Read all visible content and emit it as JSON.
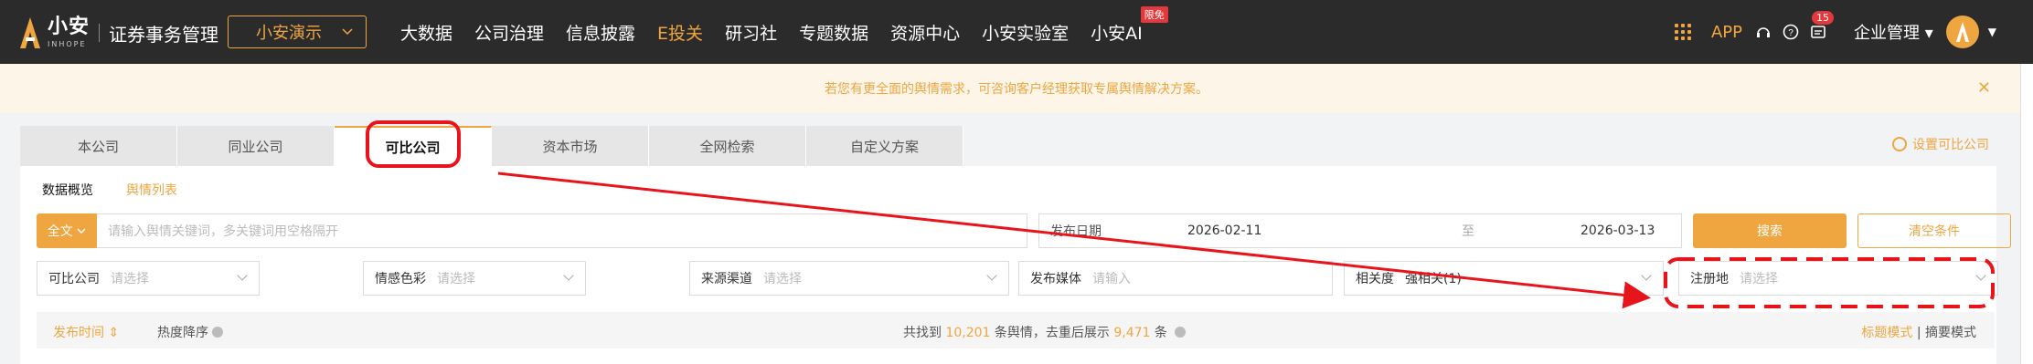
{
  "topbar": {
    "logo_text": "小安",
    "logo_sub": "INHOPE",
    "system_title": "证券事务管理",
    "demo_select": "小安演示",
    "nav": [
      {
        "label": "大数据",
        "active": false
      },
      {
        "label": "公司治理",
        "active": false
      },
      {
        "label": "信息披露",
        "active": false
      },
      {
        "label": "E投关",
        "active": true
      },
      {
        "label": "研习社",
        "active": false
      },
      {
        "label": "专题数据",
        "active": false
      },
      {
        "label": "资源中心",
        "active": false
      },
      {
        "label": "小安实验室",
        "active": false
      },
      {
        "label": "小安AI",
        "active": false,
        "badge": "限免"
      }
    ],
    "app_label": "APP",
    "notification_count": "15",
    "enterprise_menu": "企业管理",
    "accent_color": "#f0a640"
  },
  "notice": {
    "text": "若您有更全面的舆情需求，可咨询客户经理获取专属舆情解决方案。"
  },
  "tabs": [
    "本公司",
    "同业公司",
    "可比公司",
    "资本市场",
    "全网检索",
    "自定义方案"
  ],
  "active_tab": "可比公司",
  "set_compare_label": "设置可比公司",
  "subtabs": {
    "overview": "数据概览",
    "list": "舆情列表"
  },
  "search": {
    "scope": "全文",
    "keyword_placeholder": "请输入舆情关键词，多关键词用空格隔开",
    "date_label": "发布日期",
    "date_from": "2026-02-11",
    "date_to_sep": "至",
    "date_to": "2026-03-13",
    "search_btn": "搜索",
    "clear_btn": "清空条件"
  },
  "filters": [
    {
      "label": "可比公司",
      "value": "请选择"
    },
    {
      "label": "情感色彩",
      "value": "请选择"
    },
    {
      "label": "来源渠道",
      "value": "请选择"
    },
    {
      "label": "发布媒体",
      "value": "请输入"
    },
    {
      "label": "相关度",
      "value": "强相关(1)"
    },
    {
      "label": "注册地",
      "value": "请选择"
    }
  ],
  "listbar": {
    "sort_time": "发布时间",
    "sort_heat": "热度降序",
    "count_prefix": "共找到",
    "count_total": "10,201",
    "count_mid": "条舆情，去重后展示",
    "count_dedup": "9,471",
    "count_suffix": "条",
    "mode_title": "标题模式",
    "mode_sep": "|",
    "mode_summary": "摘要模式"
  }
}
